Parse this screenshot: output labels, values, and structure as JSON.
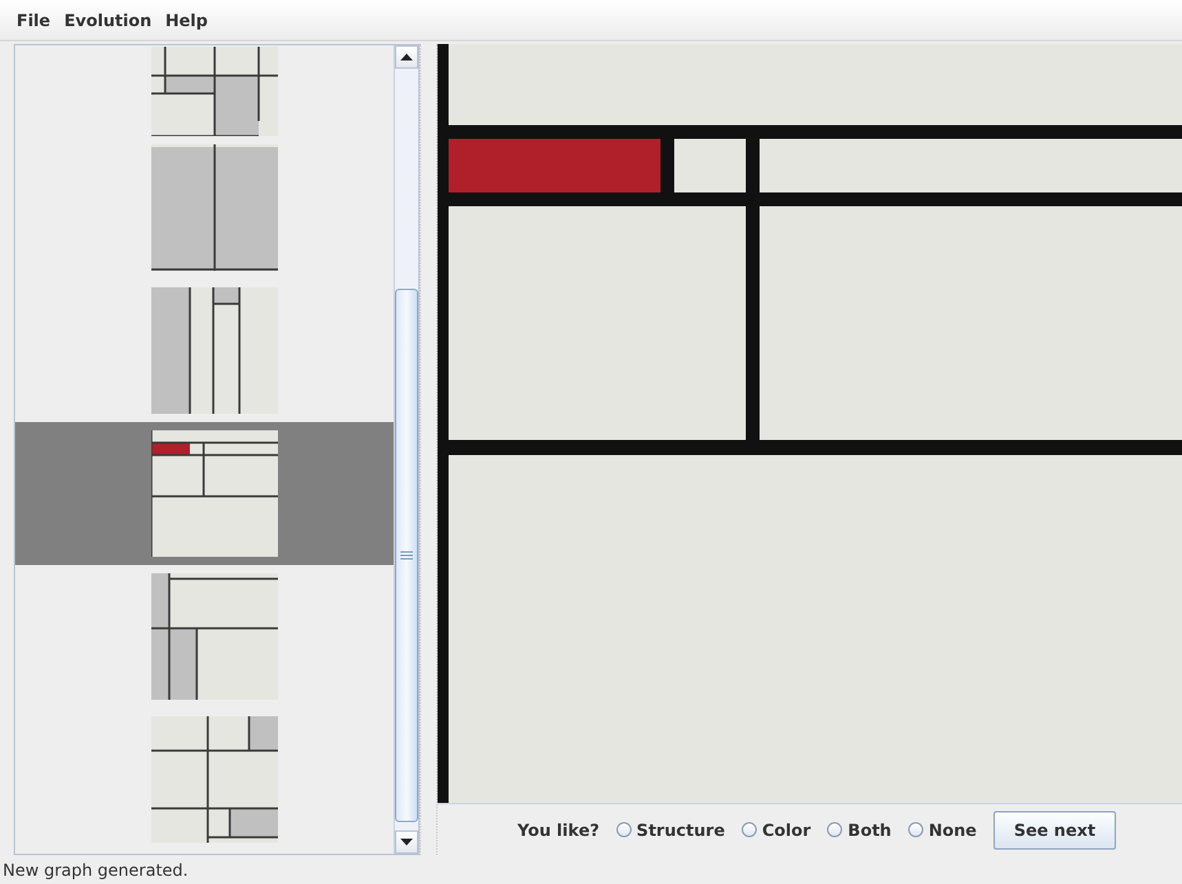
{
  "menu": [
    {
      "label": "File"
    },
    {
      "label": "Evolution"
    },
    {
      "label": "Help"
    }
  ],
  "gallery": {
    "items": [
      {
        "selected": false
      },
      {
        "selected": false
      },
      {
        "selected": false
      },
      {
        "selected": true
      },
      {
        "selected": false
      },
      {
        "selected": false
      }
    ]
  },
  "rating": {
    "prompt": "You like?",
    "options": [
      {
        "label": "Structure",
        "selected": false
      },
      {
        "label": "Color",
        "selected": false
      },
      {
        "label": "Both",
        "selected": false
      },
      {
        "label": "None",
        "selected": false
      }
    ],
    "button": "See next"
  },
  "status_bar": "New graph generated."
}
